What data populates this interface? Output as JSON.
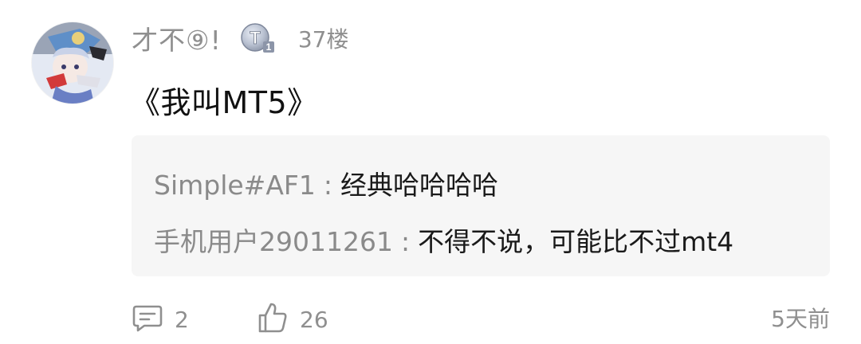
{
  "comment": {
    "username": "才不⑨!",
    "badge_letter": "T",
    "badge_sub": "1",
    "floor": "37楼",
    "text": "《我叫MT5》",
    "replies": [
      {
        "user": "Simple#AF1",
        "sep": ":",
        "text": "经典哈哈哈哈"
      },
      {
        "user": "手机用户29011261",
        "sep": ":",
        "text": "不得不说，可能比不过mt4"
      }
    ],
    "actions": {
      "comment_count": "2",
      "like_count": "26"
    },
    "time": "5天前"
  },
  "colors": {
    "meta_gray": "#8f8f8f",
    "text_dark": "#111111",
    "reply_bg": "#f6f6f6"
  },
  "icons": {
    "comment": "comment-bubble-icon",
    "like": "thumbs-up-icon",
    "badge": "level-badge-icon"
  }
}
